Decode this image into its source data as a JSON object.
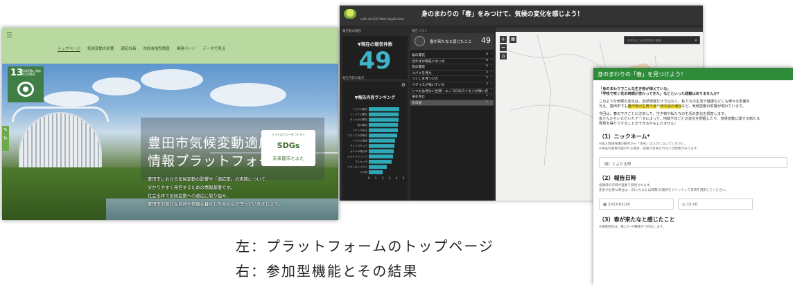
{
  "left": {
    "nav_items": [
      "トップページ",
      "気候変動の影響",
      "適応計画",
      "市民参加型調査",
      "関連ページ",
      "データで見る"
    ],
    "sdg": {
      "number": "13",
      "label": "気候変動に具体的な対策を"
    },
    "title_line1": "豊田市気候変動適応",
    "title_line2": "情報プラットフォーム",
    "sdgs_card": {
      "top": "ミライのフツーをつくろう",
      "logo": "SDGs",
      "city": "未来都市とよた"
    },
    "desc": [
      "豊田市における気候変動の影響や「適応策」の実施について、",
      "分かりやすく発信するための情報基盤です。",
      "社会全体で気候変動への適応に取り組み、",
      "豊田市の豊かな自然や快適な暮らしをみんなで守っていきましょう。"
    ]
  },
  "mid": {
    "title": "身のまわりの「春」をみつけて、気候の変化を感じよう！",
    "subtitle": "with ArcGIS Web AppBuilder",
    "pane1_label": "報告数の推移",
    "count_label": "▼現在の報告件数",
    "count_value": "49",
    "pane2_label": "報告内容の集計",
    "rank_title": "▼報告内容ランキング",
    "list_label": "報告リスト",
    "list_head_text": "春が来たなと感じたこと",
    "list_head_num": "49",
    "list_rows": [
      {
        "label": "桜の開花",
        "count": "8"
      },
      {
        "label": "ぽかぽか陽気になった",
        "count": "6"
      },
      {
        "label": "花の開花",
        "count": "6"
      },
      {
        "label": "ツバメを見た",
        "count": "5"
      },
      {
        "label": "つくしを見つけた",
        "count": "5"
      },
      {
        "label": "ウグイスが鳴いていた",
        "count": "3"
      },
      {
        "label": "いつもは見ない生物・エノコロのスイセンが咲いた",
        "count": "2"
      },
      {
        "label": "虫を見た",
        "count": "1"
      },
      {
        "label": "その他",
        "count": "1"
      }
    ],
    "search_placeholder": "住所または目標物の検索",
    "map_buttons": [
      "+",
      "−",
      "⌂"
    ],
    "rank_axis": [
      "0",
      "1",
      "2",
      "3",
      "4",
      "5"
    ]
  },
  "chart_data": {
    "type": "bar",
    "title": "▼報告内容ランキング",
    "categories": [
      "ミモザの開花",
      "ナノハナの開花",
      "タンポポの開花",
      "桜の開花",
      "ツクシが出る",
      "ウグイスの初鳴き",
      "ツバメの飛来",
      "モンシロチョウ",
      "カエルの鳴き声",
      "ヒメオドリコソウ",
      "ホトケノザ",
      "オオイヌノフグリ",
      "その他"
    ],
    "values": [
      4.4,
      4.3,
      4.3,
      4.2,
      4.2,
      4.1,
      3.8,
      3.7,
      3.6,
      3.5,
      3.3,
      2.6,
      2.0
    ],
    "xlim": [
      0,
      5
    ],
    "color": "#2fa9b8"
  },
  "right": {
    "header": "身のまわりの「春」を見つけよう！",
    "intro_bold": [
      "「身のまわりでこんな生き物が増えている」",
      "「学校で咲く花の時期が変わってきた」などといった経験はありませんか？"
    ],
    "intro": [
      "このような気候の変化は、自然環境だけではなく、私たちの生活や健康などにも様々な影響を",
      "与え、豊田市でも",
      "農作物の生育不良",
      "や",
      "熱中症の増加",
      "など、気候変動の影響が現れています。"
    ],
    "intro2": [
      "今回は、春のできごとに注目して、生き物や私たちの生活の変化を調査します。",
      "皆さんからいただいたデータによって、地域や年ごとの変化を把握したり、気候変動に関する新たな",
      "発見を得たりすることができるかもしれません！"
    ],
    "s1_title": "（1）ニックネーム*",
    "s1_notes": [
      "※個人情報保護の観点から「本名」は入力しないでください。",
      "※本名の使用が疑われる場合、結果が反映されない可能性があります。"
    ],
    "s1_placeholder": "例）とよた太郎",
    "s2_title": "（2）報告日時",
    "s2_notes": [
      "投稿時の日時が自動で反映されます。",
      "変更が必要な場合は、[日にちまたは時間]の箇所をクリックして日時を選択してください。"
    ],
    "s2_date": "2022/02/18",
    "s2_time": "15:00",
    "s3_title": "（3）春が来たなと感じたこと",
    "s3_note": "※複数回答は、枝に5〜6種類ずつ対応します。"
  },
  "captions": {
    "left": "左：プラットフォームのトップページ",
    "right": "右：参加型機能とその結果"
  }
}
